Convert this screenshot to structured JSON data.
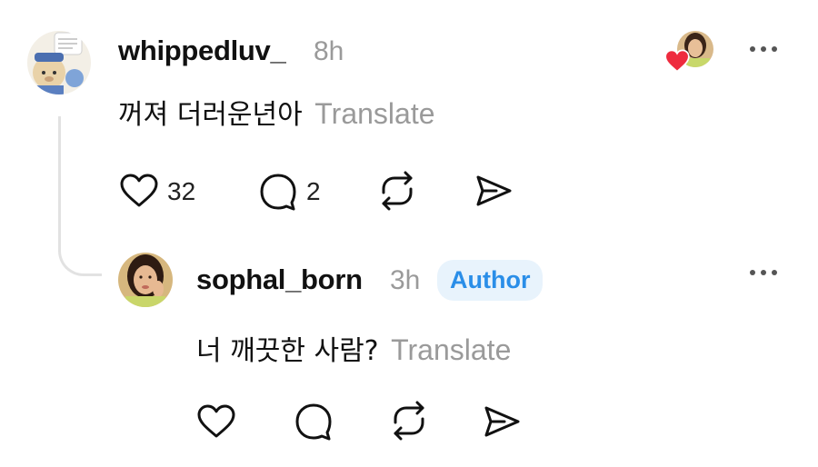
{
  "comment": {
    "username": "whippedluv_",
    "time": "8h",
    "text": "꺼져 더러운년아",
    "translate_label": "Translate",
    "like_count": "32",
    "reply_count": "2"
  },
  "reply": {
    "username": "sophal_born",
    "time": "3h",
    "badge": "Author",
    "text": "너 깨끗한 사람?",
    "translate_label": "Translate"
  },
  "icons": {
    "like": "heart-outline-icon",
    "comment": "speech-bubble-icon",
    "repost": "repost-icon",
    "share": "send-icon",
    "more": "more-horizontal-icon",
    "liked_by_author": "heart-filled-icon"
  },
  "colors": {
    "author_badge_bg": "#e8f3fc",
    "author_badge_text": "#2a8ee8",
    "heart_red": "#ee2b3e",
    "muted_text": "#9a9a9a"
  }
}
